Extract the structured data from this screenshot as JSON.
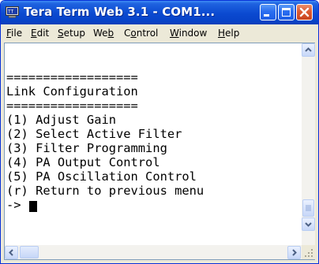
{
  "window": {
    "title": "Tera Term Web 3.1 - COM1..."
  },
  "menu": {
    "items": [
      {
        "label": "File",
        "mnemonic": "F",
        "rest": "ile"
      },
      {
        "label": "Edit",
        "mnemonic": "E",
        "rest": "dit"
      },
      {
        "label": "Setup",
        "mnemonic": "S",
        "rest": "etup"
      },
      {
        "label": "Web",
        "pre": "We",
        "mnemonic": "b"
      },
      {
        "label": "Control",
        "pre": "C",
        "mnemonic": "o",
        "rest": "ntrol"
      },
      {
        "label": "Window",
        "mnemonic": "W",
        "rest": "indow"
      },
      {
        "label": "Help",
        "mnemonic": "H",
        "rest": "elp"
      }
    ]
  },
  "terminal": {
    "lines": [
      "==================",
      "Link Configuration",
      "==================",
      "(1) Adjust Gain",
      "(2) Select Active Filter",
      "(3) Filter Programming",
      "(4) PA Output Control",
      "(5) PA Oscillation Control",
      "(r) Return to previous menu",
      "->"
    ]
  },
  "colors": {
    "titlebar": "#0a49d0",
    "close_button": "#dc5a32",
    "terminal_background": "#ffffff",
    "terminal_text": "#000000"
  }
}
